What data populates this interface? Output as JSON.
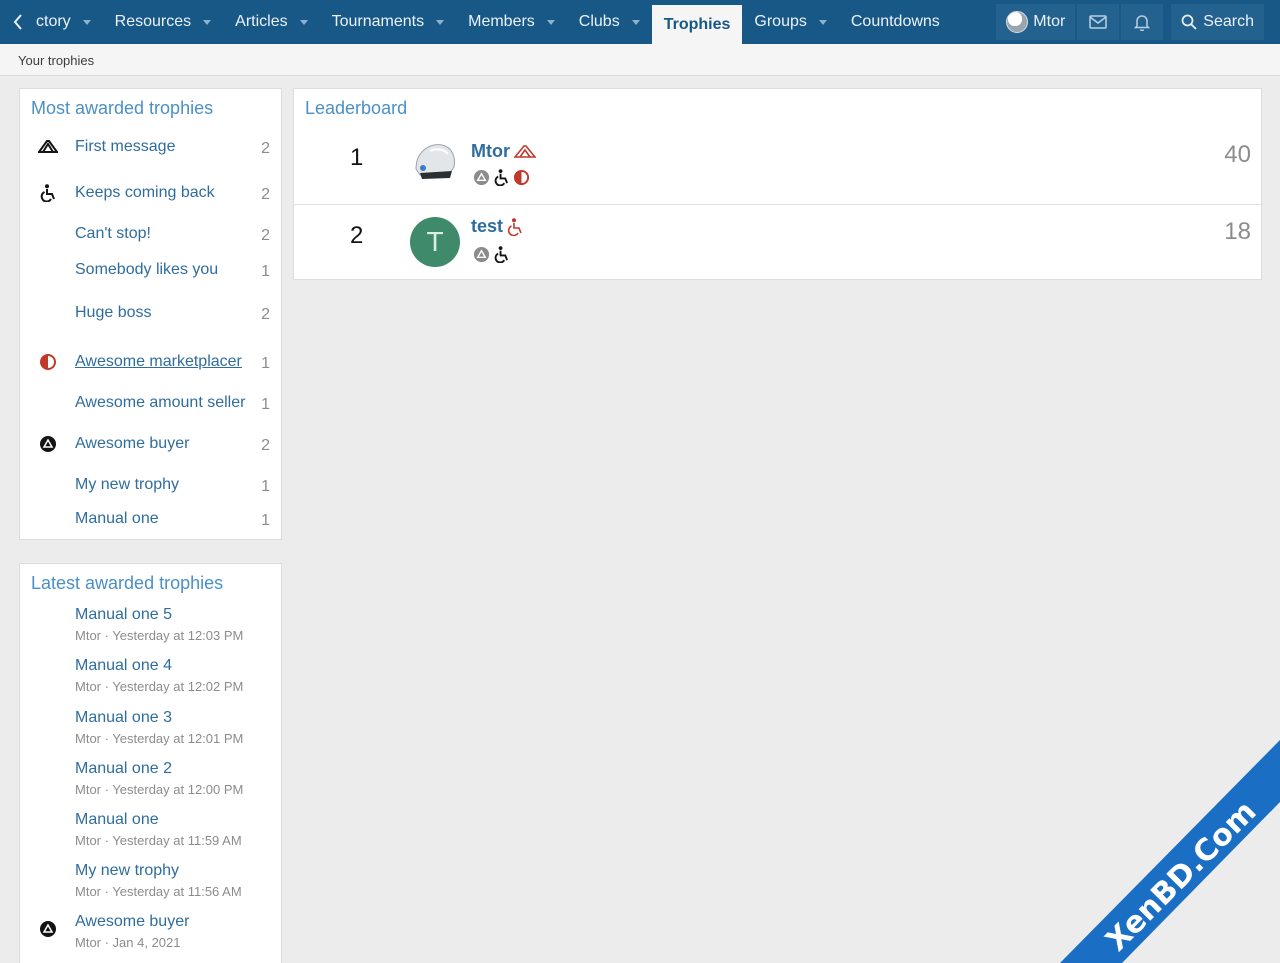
{
  "nav": {
    "back_label": "ctory",
    "tabs": [
      {
        "label": "Resources",
        "dropdown": true
      },
      {
        "label": "Articles",
        "dropdown": true
      },
      {
        "label": "Tournaments",
        "dropdown": true
      },
      {
        "label": "Members",
        "dropdown": true
      },
      {
        "label": "Clubs",
        "dropdown": true
      },
      {
        "label": "Trophies",
        "dropdown": false,
        "active": true
      },
      {
        "label": "Groups",
        "dropdown": true
      },
      {
        "label": "Countdowns",
        "dropdown": false
      }
    ],
    "user_label": "Mtor",
    "search_label": "Search"
  },
  "subnav": {
    "label": "Your trophies"
  },
  "most_awarded": {
    "title": "Most awarded trophies",
    "items": [
      {
        "name": "First message",
        "count": "2",
        "icon": "red-cross-icon"
      },
      {
        "name": "Keeps coming back",
        "count": "2",
        "icon": "wheelchair-icon"
      },
      {
        "name": "Can't stop!",
        "count": "2",
        "icon": ""
      },
      {
        "name": "Somebody likes you",
        "count": "1",
        "icon": ""
      },
      {
        "name": "Huge boss",
        "count": "2",
        "icon": ""
      },
      {
        "name": "Awesome marketplacer",
        "count": "1",
        "icon": "half-circle-icon"
      },
      {
        "name": "Awesome amount seller",
        "count": "1",
        "icon": ""
      },
      {
        "name": "Awesome buyer",
        "count": "2",
        "icon": "triangle-circle-icon"
      },
      {
        "name": "My new trophy",
        "count": "1",
        "icon": ""
      },
      {
        "name": "Manual one",
        "count": "1",
        "icon": ""
      }
    ]
  },
  "latest_awarded": {
    "title": "Latest awarded trophies",
    "items": [
      {
        "name": "Manual one 5",
        "meta": "Mtor · Yesterday at 12:03 PM",
        "icon": ""
      },
      {
        "name": "Manual one 4",
        "meta": "Mtor · Yesterday at 12:02 PM",
        "icon": ""
      },
      {
        "name": "Manual one 3",
        "meta": "Mtor · Yesterday at 12:01 PM",
        "icon": ""
      },
      {
        "name": "Manual one 2",
        "meta": "Mtor · Yesterday at 12:00 PM",
        "icon": ""
      },
      {
        "name": "Manual one",
        "meta": "Mtor · Yesterday at 11:59 AM",
        "icon": ""
      },
      {
        "name": "My new trophy",
        "meta": "Mtor · Yesterday at 11:56 AM",
        "icon": ""
      },
      {
        "name": "Awesome buyer",
        "meta": "Mtor · Jan 4, 2021",
        "icon": "triangle-circle-icon"
      }
    ]
  },
  "leaderboard": {
    "title": "Leaderboard",
    "rows": [
      {
        "rank": "1",
        "name": "Mtor",
        "points": "40",
        "avatar_letter": ""
      },
      {
        "rank": "2",
        "name": "test",
        "points": "18",
        "avatar_letter": "T"
      }
    ]
  },
  "watermark": {
    "text": "XenBD.Com"
  },
  "colors": {
    "nav_bg": "#185886",
    "link": "#2f6d9e",
    "block_title": "#4a90c6",
    "accent_red": "#c0392b",
    "watermark": "#1a6fc4"
  }
}
